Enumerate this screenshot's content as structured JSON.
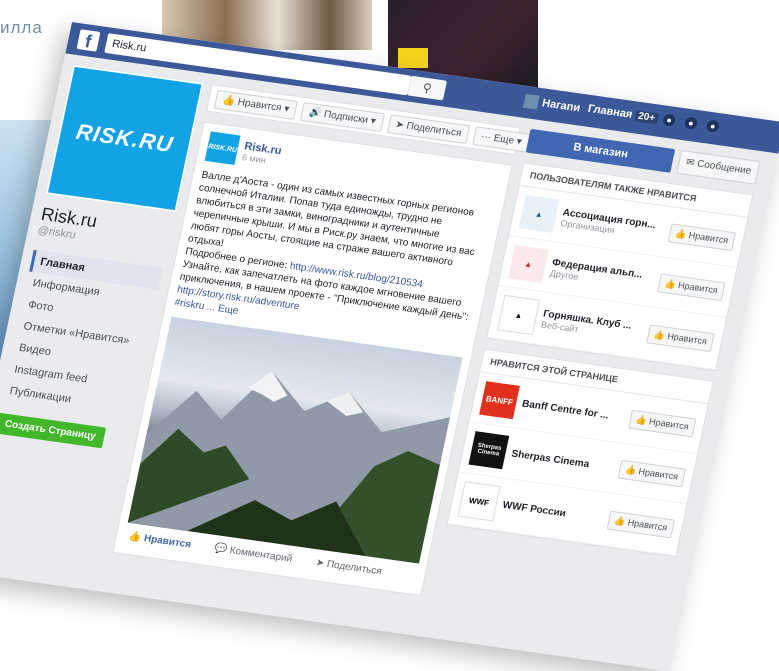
{
  "background": {
    "text": "илла"
  },
  "topbar": {
    "search_value": "Risk.ru",
    "search_icon": "search-icon",
    "user_name": "Нагапи",
    "home_label": "Главная",
    "home_count": "20+"
  },
  "page": {
    "logo_text": "RISK.RU",
    "name": "Risk.ru",
    "handle": "@riskru",
    "nav": [
      {
        "label": "Главная"
      },
      {
        "label": "Информация"
      },
      {
        "label": "Фото"
      },
      {
        "label": "Отметки «Нравится»"
      },
      {
        "label": "Видео"
      },
      {
        "label": "Instagram feed"
      },
      {
        "label": "Публикации"
      }
    ],
    "create_button": "Создать Страницу"
  },
  "actions": {
    "like": "Нравится",
    "subscribe": "Подписки",
    "share": "Поделиться",
    "more": "Еще"
  },
  "post": {
    "author": "Risk.ru",
    "time": "6 мин",
    "text1": "Валле д'Аоста - один из самых известных горных регионов солнечной Италии. Попав туда единожды, трудно не влюбиться в эти замки, виноградники и аутентичные черепичные крыши. И мы в Риск.ру знаем, что многие из вас любят горы Аосты, стоящие на страже вашего активного отдыха!",
    "text2_prefix": "Подробнее о регионе: ",
    "link1": "http://www.risk.ru/blog/210534",
    "text3": "Узнайте, как запечатлеть на фото каждое мгновение вашего приключения, в нашем проекте - \"Приключение каждый день\":",
    "link2": "http://story.risk.ru/adventure",
    "hashtag": "#riskru",
    "more": "... Еще",
    "like_action": "Нравится",
    "comment_action": "Комментарий",
    "share_action": "Поделиться"
  },
  "sidebar": {
    "shop_button": "В магазин",
    "message_button": "Сообщение",
    "users_like_title": "ПОЛЬЗОВАТЕЛЯМ ТАКЖЕ НРАВИТСЯ",
    "users_like": [
      {
        "name": "Ассоциация горн...",
        "category": "Организация",
        "button": "Нравится"
      },
      {
        "name": "Федерация альп...",
        "category": "Другое",
        "button": "Нравится"
      },
      {
        "name": "Горняшка. Клуб ...",
        "category": "Веб-сайт",
        "button": "Нравится"
      }
    ],
    "page_likes_title": "НРАВИТСЯ ЭТОЙ СТРАНИЦЕ",
    "page_likes": [
      {
        "name": "Banff Centre for ...",
        "logo": "BANFF",
        "button": "Нравится"
      },
      {
        "name": "Sherpas Cinema",
        "logo": "Sherpas Cinema",
        "button": "Нравится"
      },
      {
        "name": "WWF России",
        "logo": "WWF",
        "button": "Нравится"
      }
    ]
  },
  "colors": {
    "fb_blue": "#3b5998",
    "brand_cyan": "#12a3e7",
    "create_green": "#42b72a",
    "banff_red": "#e0301e"
  }
}
